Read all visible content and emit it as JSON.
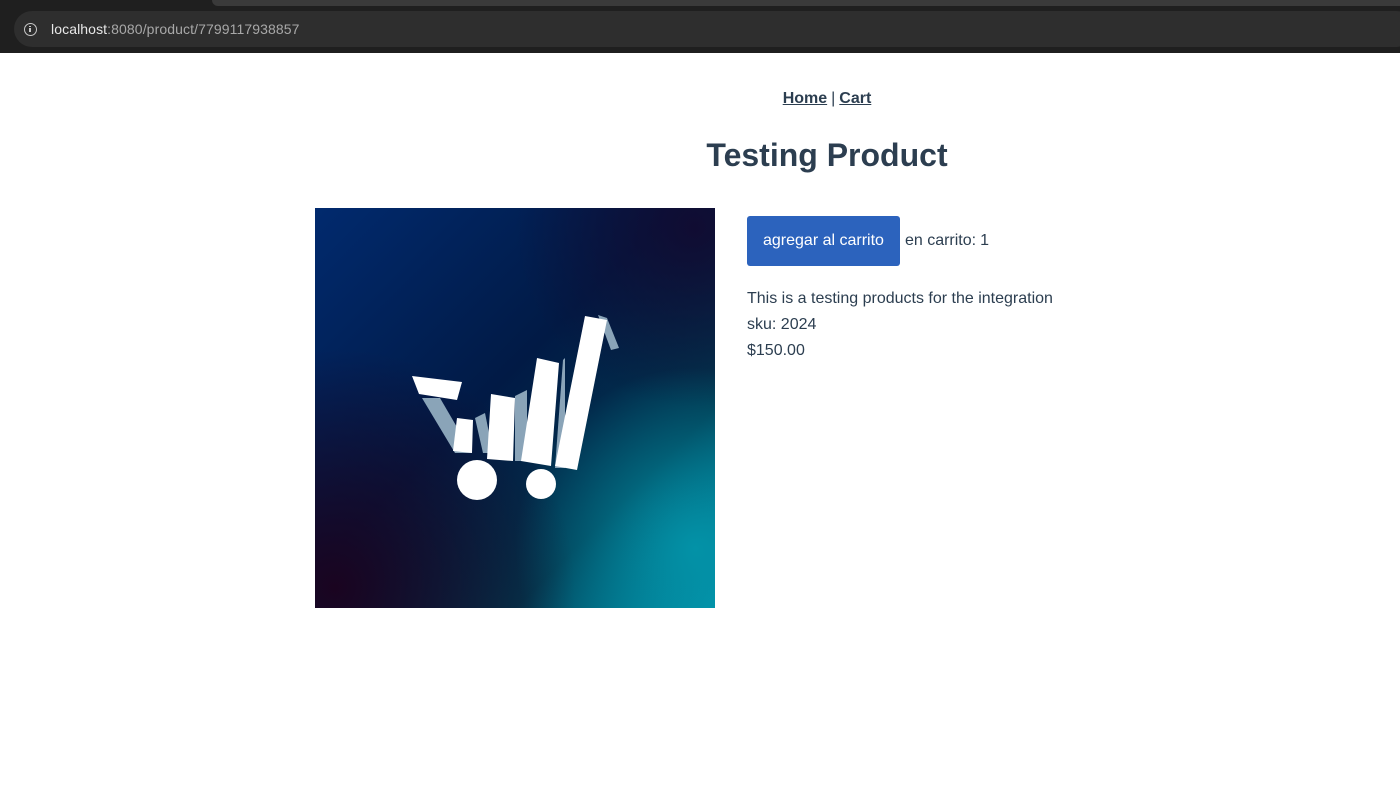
{
  "browser": {
    "url_host": "localhost",
    "url_path": ":8080/product/7799117938857"
  },
  "nav": {
    "home_label": "Home",
    "separator": "|",
    "cart_label": "Cart"
  },
  "product": {
    "title": "Testing Product",
    "add_button_label": "agregar al carrito",
    "in_cart_label": "en carrito:",
    "in_cart_count": "1",
    "description": "This is a testing products for the integration",
    "sku_label": "sku:",
    "sku": "2024",
    "price": "$150.00",
    "image_icon": "shopping-cart-chart-logo"
  },
  "colors": {
    "text": "#2c3e50",
    "button": "#2c63bd"
  }
}
